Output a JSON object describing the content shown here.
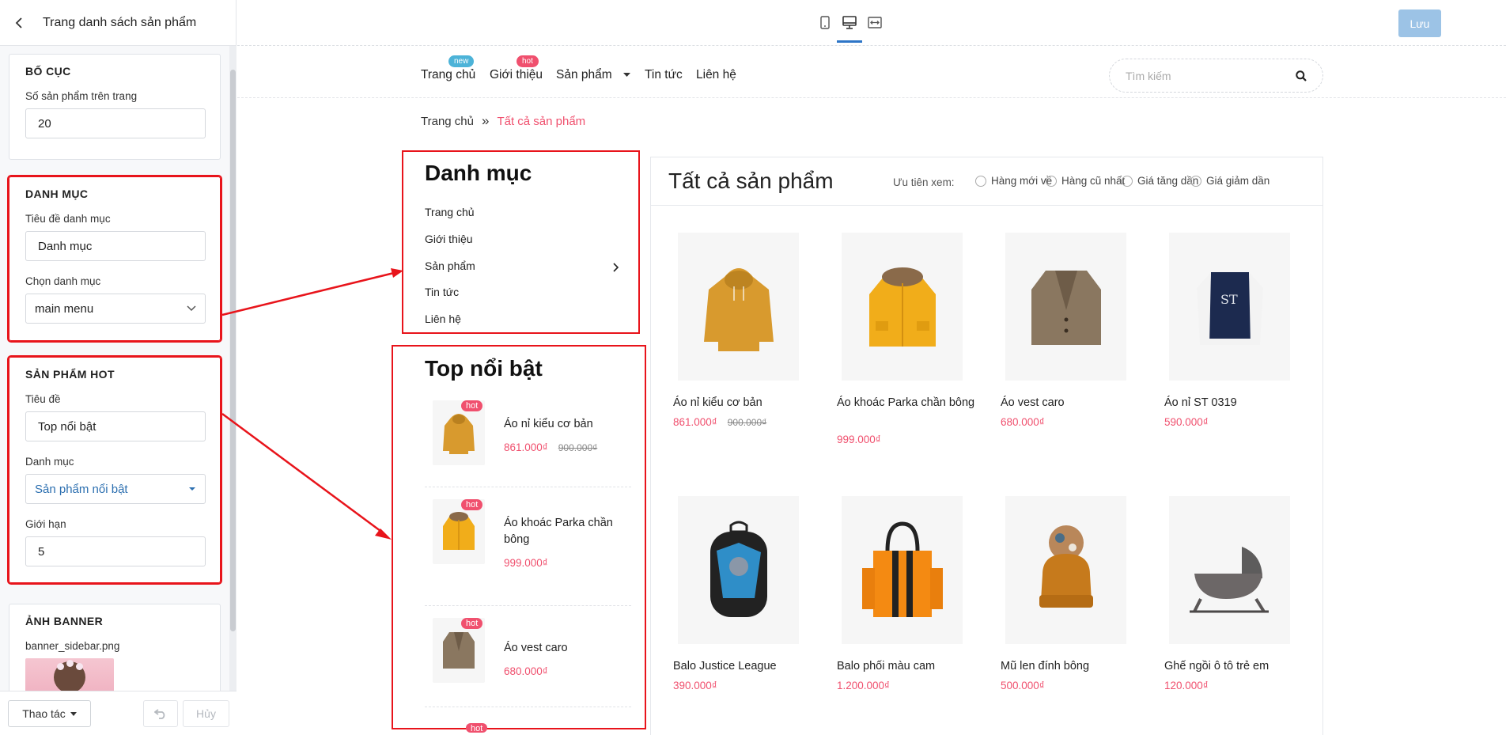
{
  "panel": {
    "title": "Trang danh sách sản phẩm",
    "layout": {
      "heading": "BỐ CỤC",
      "per_page_label": "Số sản phẩm trên trang",
      "per_page_value": "20"
    },
    "category": {
      "heading": "DANH MỤC",
      "title_label": "Tiêu đề danh mục",
      "title_value": "Danh mục",
      "choose_label": "Chọn danh mục",
      "choose_value": "main menu"
    },
    "hot": {
      "heading": "SẢN PHẨM HOT",
      "title_label": "Tiêu đề",
      "title_value": "Top nổi bật",
      "collection_label": "Danh mục",
      "collection_value": "Sản phẩm nổi bật",
      "limit_label": "Giới hạn",
      "limit_value": "5"
    },
    "banner": {
      "heading": "ẢNH BANNER",
      "file": "banner_sidebar.png"
    },
    "footer": {
      "actions_label": "Thao tác",
      "cancel_label": "Hủy"
    }
  },
  "toolbar": {
    "save_label": "Lưu",
    "active_device": "desktop"
  },
  "nav": {
    "items": [
      {
        "label": "Trang chủ",
        "badge": "new",
        "badge_color": "#4cb3d8"
      },
      {
        "label": "Giới thiệu",
        "badge": "hot",
        "badge_color": "#f0506e"
      },
      {
        "label": "Sản phẩm"
      },
      {
        "label": "Tin tức"
      },
      {
        "label": "Liên hệ"
      }
    ],
    "search_placeholder": "Tìm kiếm"
  },
  "breadcrumb": {
    "home": "Trang chủ",
    "separator": "»",
    "current": "Tất cả sản phẩm"
  },
  "sidebar": {
    "category_title": "Danh mục",
    "category_items": [
      "Trang chủ",
      "Giới thiệu",
      "Sản phẩm",
      "Tin tức",
      "Liên hệ"
    ],
    "hot_title": "Top nổi bật",
    "hot_badge": "hot",
    "hot_items": [
      {
        "name": "Áo nỉ kiểu cơ bản",
        "price": "861.000₫",
        "old_price": "900.000₫"
      },
      {
        "name": "Áo khoác Parka chần bông",
        "price": "999.000₫"
      },
      {
        "name": "Áo vest caro",
        "price": "680.000₫"
      }
    ]
  },
  "main": {
    "title": "Tất cả sản phẩm",
    "sort_label": "Ưu tiên xem:",
    "sort_options": [
      "Hàng mới về",
      "Hàng cũ nhất",
      "Giá tăng dần",
      "Giá giảm dần"
    ],
    "products": [
      {
        "name": "Áo nỉ kiểu cơ bản",
        "price": "861.000₫",
        "old_price": "900.000₫"
      },
      {
        "name": "Áo khoác Parka chần bông",
        "price": "999.000₫"
      },
      {
        "name": "Áo vest caro",
        "price": "680.000₫"
      },
      {
        "name": "Áo nỉ ST 0319",
        "price": "590.000₫"
      },
      {
        "name": "Balo Justice League",
        "price": "390.000₫"
      },
      {
        "name": "Balo phối màu cam",
        "price": "1.200.000₫"
      },
      {
        "name": "Mũ len đính bông",
        "price": "500.000₫"
      },
      {
        "name": "Ghế ngồi ô tô trẻ em",
        "price": "120.000₫"
      }
    ]
  },
  "colors": {
    "accent": "#f0506e",
    "annotation": "#e8141b",
    "primary": "#2d75c7"
  }
}
